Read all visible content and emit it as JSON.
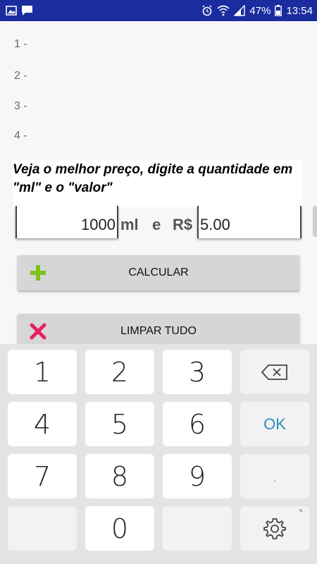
{
  "status_bar": {
    "battery_percent": "47%",
    "time": "13:54"
  },
  "results": [
    "1 -",
    "2 -",
    "3 -",
    "4 -"
  ],
  "instruction": "Veja o melhor preço, digite a quantidade em \"ml\" e o \"valor\"",
  "inputs": {
    "ml_value": "1000",
    "ml_label": "ml",
    "e_label": "e",
    "currency_label": "R$",
    "valor_value": "5.00"
  },
  "buttons": {
    "calculate": "CALCULAR",
    "clear_all": "LIMPAR TUDO"
  },
  "colors": {
    "status_bar": "#1a2c9e",
    "add_icon": "#7cc21a",
    "clear_icon": "#e81e63",
    "ok_key": "#2d8fb4"
  },
  "keyboard": {
    "keys": [
      "1",
      "2",
      "3",
      "4",
      "5",
      "6",
      "7",
      "8",
      "9",
      "0"
    ],
    "ok": "OK",
    "dot": "."
  }
}
